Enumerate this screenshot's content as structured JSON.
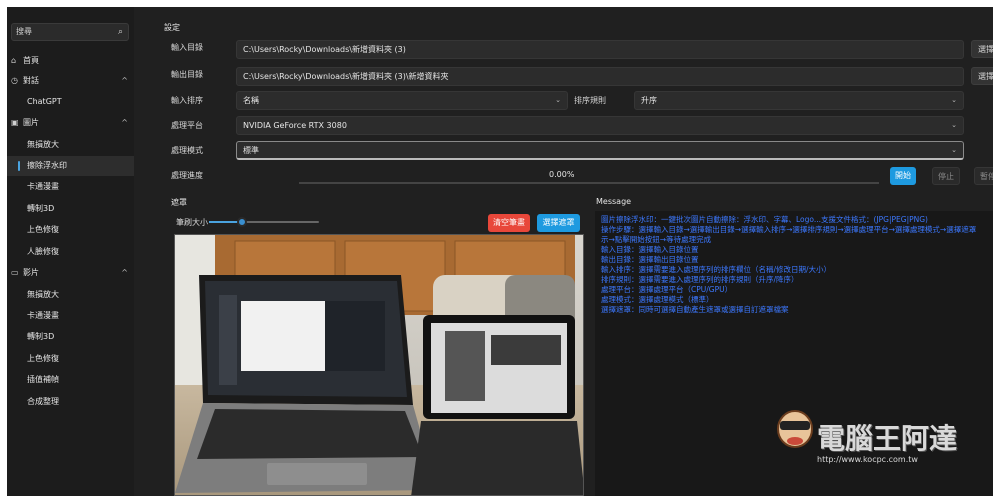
{
  "sidebar": {
    "search_value": "搜尋",
    "items": [
      {
        "label": "首頁",
        "icon": "home-icon"
      },
      {
        "label": "對話",
        "icon": "chat-icon"
      },
      {
        "label": "ChatGPT"
      },
      {
        "label": "圖片",
        "icon": "image-icon"
      },
      {
        "label": "無損放大"
      },
      {
        "label": "擦除浮水印"
      },
      {
        "label": "卡通漫畫"
      },
      {
        "label": "轉制3D"
      },
      {
        "label": "上色修復"
      },
      {
        "label": "人臉修復"
      },
      {
        "label": "影片",
        "icon": "video-icon"
      },
      {
        "label": "無損放大"
      },
      {
        "label": "卡通漫畫"
      },
      {
        "label": "轉制3D"
      },
      {
        "label": "上色修復"
      },
      {
        "label": "插值補幀"
      },
      {
        "label": "合成整理"
      }
    ]
  },
  "settings": {
    "title": "設定",
    "input_dir_label": "輸入目錄",
    "input_dir_value": "C:\\Users\\Rocky\\Downloads\\新增資料夾 (3)",
    "output_dir_label": "輸出目錄",
    "output_dir_value": "C:\\Users\\Rocky\\Downloads\\新增資料夾 (3)\\新增資料夾",
    "browse_label": "選擇",
    "sort_label": "輸入排序",
    "sort_value": "名稱",
    "sort_rule_label": "排序規則",
    "sort_rule_value": "升序",
    "platform_label": "處理平台",
    "platform_value": "NVIDIA GeForce RTX 3080",
    "mode_label": "處理模式",
    "mode_value": "標準",
    "progress_label": "處理進度",
    "progress_text": "0.00%",
    "progress": 0,
    "start_label": "開始",
    "stop_label": "停止",
    "pause_label": "暫停"
  },
  "mask": {
    "title": "遮罩",
    "brush_label": "筆刷大小",
    "brush_level": 0.3,
    "clear_label": "清空筆畫",
    "select_label": "選擇遮罩"
  },
  "message": {
    "title": "Message",
    "lines": [
      "圖片擦除浮水印：一鍵批次圖片自動擦除：浮水印、字幕、Logo...支援文件格式：(JPG|PEG|PNG)",
      "操作步驟：選擇輸入目錄→選擇輸出目錄→選擇輸入排序→選擇排序規則→選擇處理平台→選擇處理模式→選擇遮罩",
      "示→點擊開始按鈕→等待處理完成",
      "輸入目錄：選擇輸入目錄位置",
      "輸出目錄：選擇輸出目錄位置",
      "輸入排序：選擇需要進入處理序列的排序欄位（名稱/修改日期/大小）",
      "排序規則：選擇需要進入處理序列的排序規則（升序/降序）",
      "處理平台：選擇處理平台（CPU/GPU）",
      "處理模式：選擇處理模式（標準）",
      "選擇遮罩：同時可選擇自動產生遮罩或選擇自訂遮罩檔案"
    ]
  },
  "watermark": {
    "brand": "電腦王阿達",
    "url": "http://www.kocpc.com.tw"
  },
  "colors": {
    "accent": "#1e9ae0",
    "danger": "#e8473a",
    "message_text": "#3c78ff"
  }
}
